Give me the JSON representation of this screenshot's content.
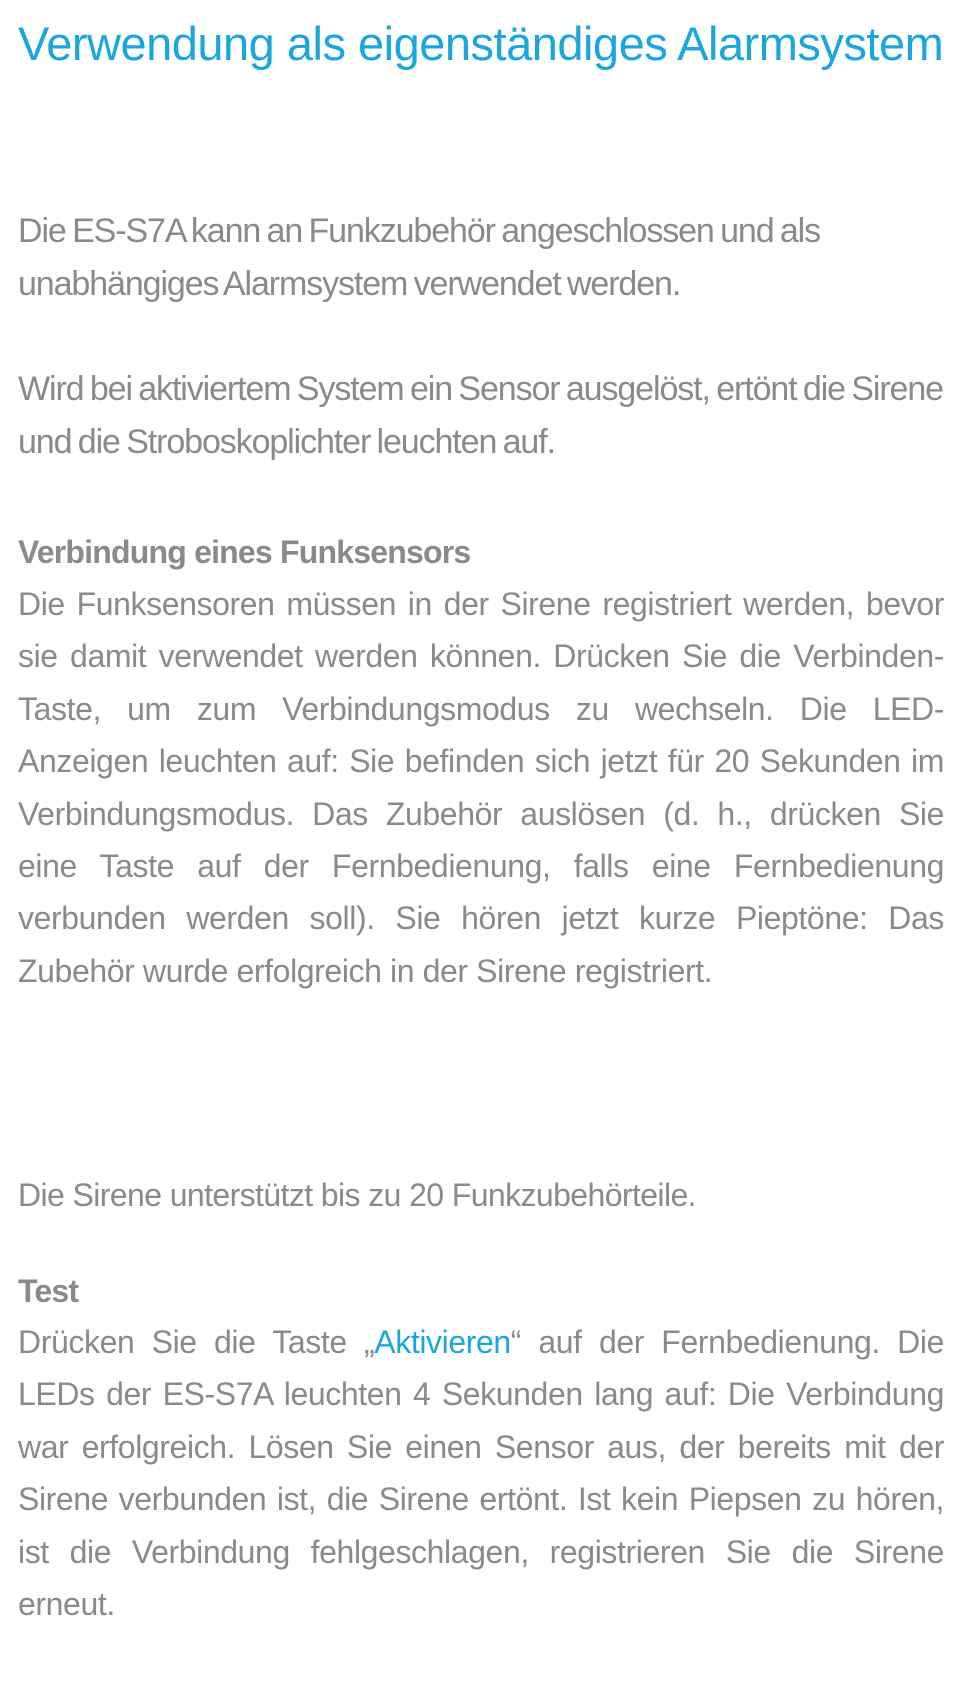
{
  "document": {
    "title": "Verwendung als eigenständiges Alarmsystem",
    "intro_paragraphs": [
      "Die ES-S7A kann an Funkzubehör angeschlossen und als unabhängiges Alarmsystem verwendet werden.",
      "Wird bei aktiviertem System ein Sensor ausgelöst, ertönt die Sirene und die Stroboskoplichter leuchten auf."
    ],
    "sections": [
      {
        "heading": "Verbindung eines Funksensors",
        "body": "Die Funksensoren müssen in der Sirene registriert werden, bevor sie damit verwendet werden können. Drücken Sie die Verbinden-Taste, um zum Verbindungsmodus zu wechseln. Die LED-Anzeigen leuchten auf: Sie befinden sich jetzt für 20 Sekunden im Verbindungsmodus. Das Zubehör auslösen (d. h., drücken Sie eine Taste auf der Fernbedienung, falls eine Fernbedienung verbunden werden soll). Sie hören jetzt kurze Pieptöne: Das Zubehör wurde erfolgreich in der Sirene registriert.",
        "note": "Die Sirene unterstützt bis zu 20 Funkzubehörteile."
      },
      {
        "heading": "Test",
        "body_before": "Drücken Sie die Taste „",
        "body_highlight": "Aktivieren",
        "body_after": "“ auf der Fernbedienung. Die LEDs der ES-S7A leuchten 4 Sekunden lang auf: Die Verbindung war erfolgreich. Lösen Sie einen Sensor aus, der bereits mit der Sirene verbunden ist, die Sirene ertönt. Ist kein Piepsen zu hören, ist die Verbindung fehlgeschlagen, registrieren Sie die Sirene erneut."
      }
    ],
    "colors": {
      "accent": "#1ba6de",
      "text": "#8a8a8c",
      "background": "#ffffff"
    }
  }
}
